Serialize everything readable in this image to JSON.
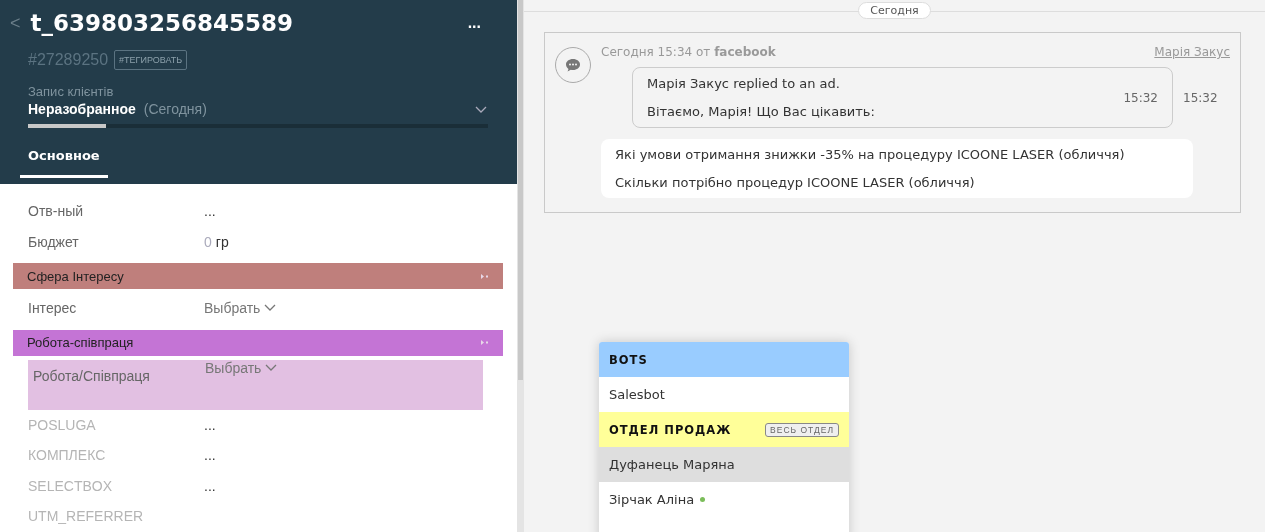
{
  "lead": {
    "back_label": "<",
    "title": "t_639803256845589",
    "menu_label": "...",
    "id": "#27289250",
    "tag_button": "#ТЕГИРОВАТЬ",
    "pipeline": "Запис клієнтів",
    "status": "Неразобранное",
    "status_date": "(Сегодня)",
    "level": 0.17,
    "tabs": [
      {
        "label": "Основное",
        "selected": true
      }
    ],
    "fields": [
      {
        "kind": "field",
        "label": "Отв-ный",
        "value": "...",
        "muted": false
      },
      {
        "kind": "field",
        "label": "Бюджет",
        "amount": "0",
        "value": "гр",
        "muted": false
      },
      {
        "kind": "section",
        "label": "Сфера Інтересу",
        "color": "#bf7f7c"
      },
      {
        "kind": "field",
        "label": "Інтерес",
        "placeholder": "Выбрать",
        "dropdown": true,
        "muted": false
      },
      {
        "kind": "section",
        "label": "Робота-співпраця",
        "color": "#c474d5"
      },
      {
        "kind": "field",
        "label": "Робота/Співпраця",
        "placeholder": "Выбрать",
        "dropdown": true,
        "highlighted": true,
        "muted": false
      },
      {
        "kind": "field",
        "label": "POSLUGA",
        "value": "...",
        "muted": true
      },
      {
        "kind": "field",
        "label": "КОМПЛЕКС",
        "value": "...",
        "muted": true
      },
      {
        "kind": "field",
        "label": "SELECTBOX",
        "value": "...",
        "muted": true
      },
      {
        "kind": "field",
        "label": "UTM_REFERRER",
        "muted": true
      }
    ]
  },
  "feed": {
    "date_label": "Сегодня",
    "message": {
      "meta": "Сегодня 15:34 от **facebook**",
      "author": "Марія Закус",
      "bubble": {
        "lines": [
          "Марія Закус replied to an ad.",
          "Вітаємо, Марія! Що Вас цікавить:"
        ],
        "time": "15:32"
      },
      "outer_time": "15:32",
      "options": [
        "Які умови отримання знижки -35% на процедуру ICOONE LASER (обличчя)",
        "Скільки потрібно процедур ICOONE LASER (обличчя)"
      ]
    }
  },
  "picker": {
    "items": [
      {
        "kind": "group",
        "label": "BOTS",
        "color": "#99ccff"
      },
      {
        "kind": "person",
        "label": "Salesbot",
        "selected": false,
        "online": false
      },
      {
        "kind": "group",
        "label": "ОТДЕЛ ПРОДАЖ",
        "color": "#ffff99",
        "badge": "ВЕСЬ ОТДЕЛ"
      },
      {
        "kind": "person",
        "label": "Дуфанець Маряна",
        "selected": true,
        "online": false
      },
      {
        "kind": "person",
        "label": "Зірчак Аліна",
        "selected": false,
        "online": true
      }
    ]
  }
}
